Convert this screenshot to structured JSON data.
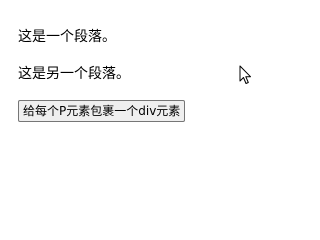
{
  "paragraphs": [
    "这是一个段落。",
    "这是另一个段落。"
  ],
  "button": {
    "label": "给每个P元素包裹一个div元素"
  },
  "cursor": {
    "icon": "arrow-cursor-icon"
  }
}
